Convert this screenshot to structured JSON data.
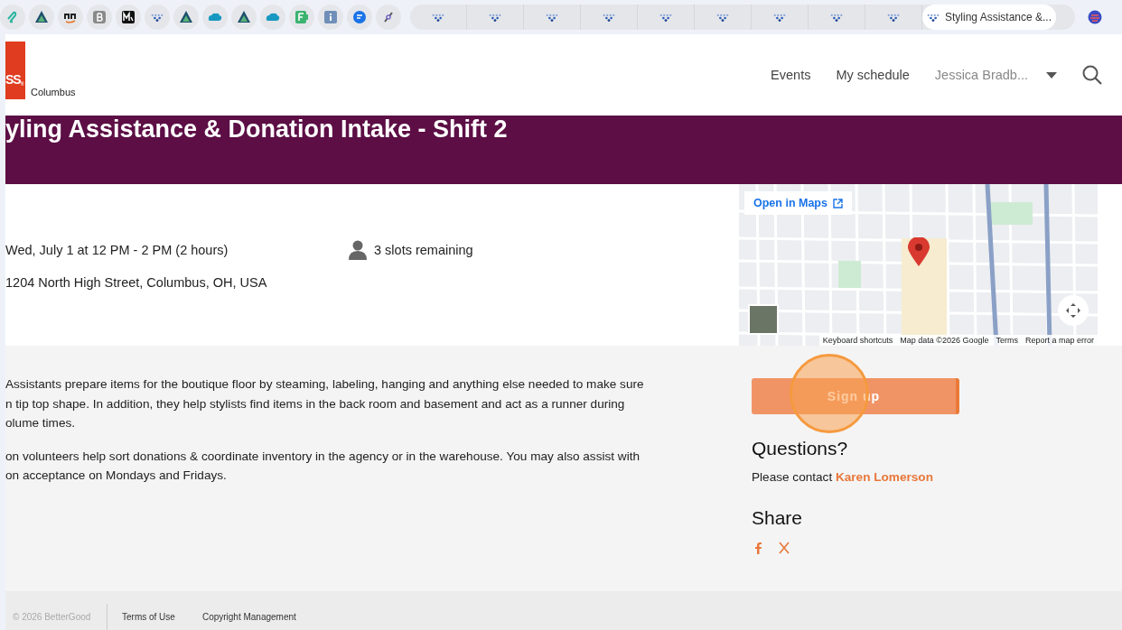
{
  "browser_tabs": [
    {
      "kind": "pinned",
      "selected": false
    },
    {
      "kind": "pinned",
      "selected": false
    },
    {
      "kind": "pinned",
      "selected": false
    },
    {
      "kind": "pinned",
      "selected": false
    },
    {
      "kind": "pinned",
      "selected": false
    },
    {
      "kind": "pinned",
      "selected": false
    },
    {
      "kind": "pinned",
      "selected": false
    },
    {
      "kind": "pinned",
      "selected": false
    },
    {
      "kind": "pinned",
      "selected": false
    },
    {
      "kind": "pinned",
      "selected": false
    },
    {
      "kind": "pinned",
      "selected": false
    },
    {
      "kind": "pinned",
      "selected": false
    },
    {
      "kind": "pinned",
      "selected": false
    },
    {
      "kind": "pinned",
      "selected": false
    },
    {
      "kind": "tab",
      "selected": false
    },
    {
      "kind": "tab",
      "selected": false
    },
    {
      "kind": "tab",
      "selected": false
    },
    {
      "kind": "tab",
      "selected": false
    },
    {
      "kind": "tab",
      "selected": false
    },
    {
      "kind": "tab",
      "selected": false
    },
    {
      "kind": "tab",
      "selected": false
    },
    {
      "kind": "tab",
      "selected": false
    },
    {
      "kind": "tab",
      "selected": false
    },
    {
      "kind": "tab",
      "title": "Styling Assistance &...",
      "selected": true
    }
  ],
  "header": {
    "logo_text": "SS",
    "logo_mark": "®",
    "region": "Columbus",
    "nav": [
      "Events",
      "My schedule"
    ],
    "user": "Jessica Bradb..."
  },
  "banner": {
    "title": "yling Assistance & Donation Intake - Shift 2"
  },
  "details": {
    "date": "Wed, July 1 at 12 PM - 2 PM (2 hours)",
    "slots": "3 slots remaining",
    "address": "1204 North High Street, Columbus, OH, USA"
  },
  "map": {
    "open_link": "Open in Maps",
    "attribution": [
      "Keyboard shortcuts",
      "Map data ©2026 Google",
      "Terms",
      "Report a map error"
    ]
  },
  "description": [
    [
      "Assistants prepare items for the boutique floor by steaming, labeling, hanging and anything else needed to make sure",
      "n tip top shape. In addition, they help stylists find items in the back room and basement and act as a runner during",
      "olume times."
    ],
    [
      "on volunteers help sort donations & coordinate inventory in the agency or in the warehouse. You may also assist with",
      "on acceptance on Mondays and Fridays."
    ]
  ],
  "sidebar": {
    "signup": "Sign up",
    "questions_heading": "Questions?",
    "contact_prefix": "Please contact",
    "contact_name": "Karen Lomerson",
    "share_heading": "Share"
  },
  "footer": {
    "copyright": "© 2026 BetterGood",
    "links": [
      "Terms of Use",
      "Copyright Management"
    ]
  }
}
